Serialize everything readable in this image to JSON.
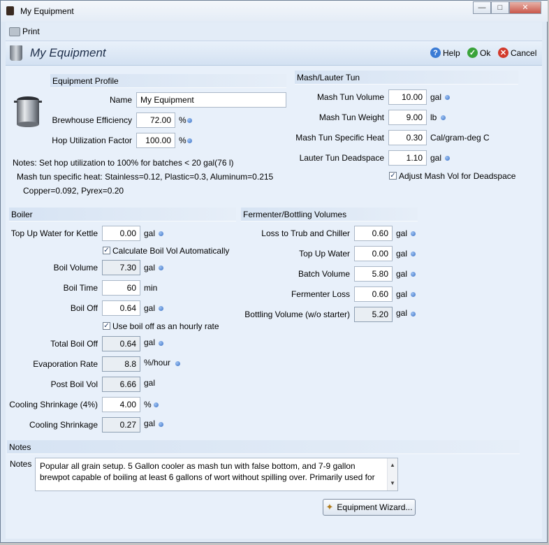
{
  "window": {
    "title": "My Equipment"
  },
  "toolbar": {
    "print_label": "Print"
  },
  "header": {
    "title": "My Equipment",
    "help_label": "Help",
    "ok_label": "Ok",
    "cancel_label": "Cancel"
  },
  "equipment_profile": {
    "section_title": "Equipment Profile",
    "name_label": "Name",
    "name_value": "My Equipment",
    "efficiency_label": "Brewhouse Efficiency",
    "efficiency_value": "72.00",
    "efficiency_unit": "%",
    "hop_label": "Hop Utilization Factor",
    "hop_value": "100.00",
    "hop_unit": "%",
    "note_line1": "Notes: Set hop utilization to 100% for batches < 20 gal(76 l)",
    "note_line2": "Mash tun specific heat: Stainless=0.12, Plastic=0.3, Aluminum=0.215",
    "note_line3": "Copper=0.092, Pyrex=0.20"
  },
  "mash": {
    "section_title": "Mash/Lauter Tun",
    "volume_label": "Mash Tun Volume",
    "volume_value": "10.00",
    "volume_unit": "gal",
    "weight_label": "Mash Tun Weight",
    "weight_value": "9.00",
    "weight_unit": "lb",
    "heat_label": "Mash Tun Specific Heat",
    "heat_value": "0.30",
    "heat_unit": "Cal/gram-deg C",
    "dead_label": "Lauter Tun Deadspace",
    "dead_value": "1.10",
    "dead_unit": "gal",
    "adjust_label": "Adjust Mash Vol for Deadspace"
  },
  "boiler": {
    "section_title": "Boiler",
    "topup_label": "Top Up Water for Kettle",
    "topup_value": "0.00",
    "topup_unit": "gal",
    "calc_label": "Calculate Boil Vol Automatically",
    "boilvol_label": "Boil Volume",
    "boilvol_value": "7.30",
    "boilvol_unit": "gal",
    "boiltime_label": "Boil Time",
    "boiltime_value": "60",
    "boiltime_unit": "min",
    "boiloff_label": "Boil Off",
    "boiloff_value": "0.64",
    "boiloff_unit": "gal",
    "hourly_label": "Use boil off as an hourly rate",
    "total_label": "Total Boil Off",
    "total_value": "0.64",
    "total_unit": "gal",
    "evap_label": "Evaporation Rate",
    "evap_value": "8.8",
    "evap_unit": "%/hour",
    "post_label": "Post Boil Vol",
    "post_value": "6.66",
    "post_unit": "gal",
    "shrinkpct_label": "Cooling Shrinkage (4%)",
    "shrinkpct_value": "4.00",
    "shrinkpct_unit": "%",
    "shrink_label": "Cooling Shrinkage",
    "shrink_value": "0.27",
    "shrink_unit": "gal"
  },
  "fermenter": {
    "section_title": "Fermenter/Bottling Volumes",
    "trub_label": "Loss to Trub and Chiller",
    "trub_value": "0.60",
    "trub_unit": "gal",
    "topup_label": "Top Up Water",
    "topup_value": "0.00",
    "topup_unit": "gal",
    "batch_label": "Batch Volume",
    "batch_value": "5.80",
    "batch_unit": "gal",
    "loss_label": "Fermenter Loss",
    "loss_value": "0.60",
    "loss_unit": "gal",
    "bottling_label": "Bottling Volume (w/o starter)",
    "bottling_value": "5.20",
    "bottling_unit": "gal"
  },
  "notes": {
    "section_title": "Notes",
    "label": "Notes",
    "text": "Popular all grain setup.  5 Gallon cooler as mash tun with false bottom, and 7-9 gallon brewpot capable of boiling at least 6 gallons of wort without spilling over.  Primarily used for"
  },
  "wizard": {
    "label": "Equipment Wizard..."
  }
}
